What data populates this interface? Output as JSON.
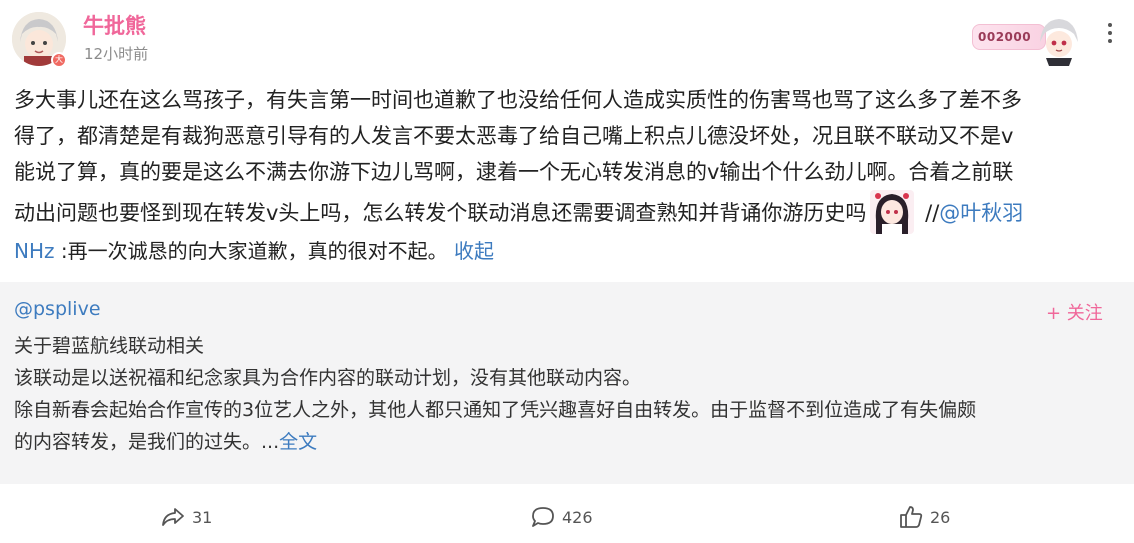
{
  "post": {
    "username": "牛批熊",
    "time": "12小时前",
    "avatar_badge": "大",
    "deco_number": "002000",
    "body_lines": [
      "多大事儿还在这么骂孩子，有失言第一时间也道歉了也没给任何人造成实质性的伤害骂也骂了这么多了差不多",
      "得了，都清楚是有裁狗恶意引导有的人发言不要太恶毒了给自己嘴上积点儿德没坏处，况且联不联动又不是v",
      "能说了算，真的要是这么不满去你游下边儿骂啊，逮着一个无心转发消息的v输出个什么劲儿啊。合着之前联",
      "动出问题也要怪到现在转发v头上吗，怎么转发个联动消息还需要调查熟知并背诵你游历史吗"
    ],
    "body_tail_sep": " //",
    "mention": "@叶秋羽",
    "note_user": "NHz",
    "note_text": " :再一次诚恳的向大家道歉，真的很对不起。 ",
    "collapse_label": "收起"
  },
  "repost": {
    "user": "@psplive",
    "follow_label": "+ 关注",
    "lines": [
      "关于碧蓝航线联动相关",
      "该联动是以送祝福和纪念家具为合作内容的联动计划，没有其他联动内容。",
      "除自新春会起始合作宣传的3位艺人之外，其他人都只通知了凭兴趣喜好自由转发。由于监督不到位造成了有失偏颇",
      "的内容转发，是我们的过失。..."
    ],
    "full_text_label": "全文"
  },
  "actions": {
    "share_count": "31",
    "comment_count": "426",
    "like_count": "26"
  },
  "colors": {
    "username": "#f0679a",
    "link": "#3d7bbf",
    "card_bg": "#f4f4f5"
  },
  "icons": [
    "more-vertical-icon",
    "share-icon",
    "comment-icon",
    "like-icon"
  ]
}
